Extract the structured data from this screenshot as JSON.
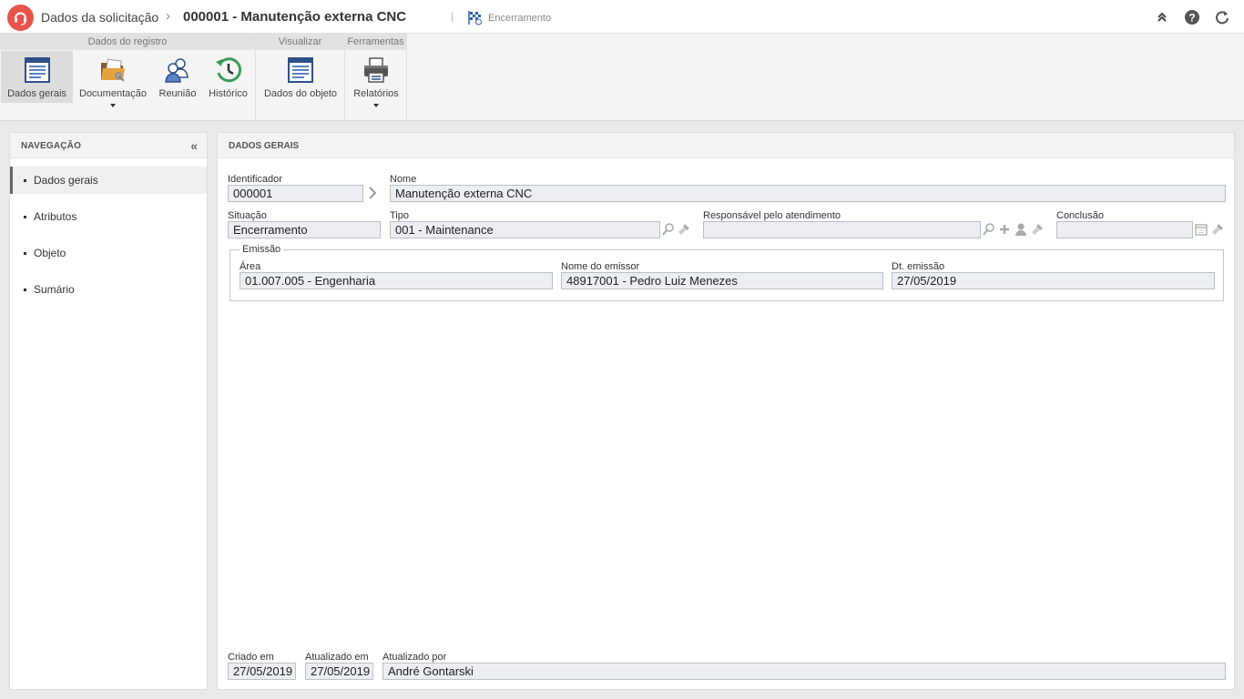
{
  "header": {
    "breadcrumb_root": "Dados da solicitação",
    "breadcrumb_sep": "›",
    "title": "000001 - Manutenção externa CNC",
    "divider": "|",
    "status": "Encerramento"
  },
  "ribbon": {
    "groups": [
      {
        "title": "Dados do registro"
      },
      {
        "title": "Visualizar"
      },
      {
        "title": "Ferramentas"
      }
    ],
    "buttons": {
      "dados_gerais": "Dados gerais",
      "documentacao": "Documentação",
      "reuniao": "Reunião",
      "historico": "Histórico",
      "dados_objeto": "Dados do objeto",
      "relatorios": "Relatórios"
    }
  },
  "nav": {
    "title": "NAVEGAÇÃO",
    "collapse": "«",
    "items": [
      {
        "label": "Dados gerais",
        "active": true
      },
      {
        "label": "Atributos"
      },
      {
        "label": "Objeto"
      },
      {
        "label": "Sumário"
      }
    ]
  },
  "form": {
    "title": "DADOS GERAIS",
    "identificador": {
      "label": "Identificador",
      "value": "000001"
    },
    "nome": {
      "label": "Nome",
      "value": "Manutenção externa CNC"
    },
    "situacao": {
      "label": "Situação",
      "value": "Encerramento"
    },
    "tipo": {
      "label": "Tipo",
      "value": "001 - Maintenance"
    },
    "responsavel": {
      "label": "Responsável pelo atendimento",
      "value": ""
    },
    "conclusao": {
      "label": "Conclusão",
      "value": ""
    },
    "emissao": {
      "legend": "Emissão",
      "area": {
        "label": "Área",
        "value": "01.007.005 - Engenharia"
      },
      "emissor": {
        "label": "Nome do emissor",
        "value": "48917001 - Pedro Luiz Menezes"
      },
      "dt_emissao": {
        "label": "Dt. emissão",
        "value": "27/05/2019"
      }
    },
    "criado_em": {
      "label": "Criado em",
      "value": "27/05/2019"
    },
    "atualizado_em": {
      "label": "Atualizado em",
      "value": "27/05/2019"
    },
    "atualizado_por": {
      "label": "Atualizado por",
      "value": "André Gontarski"
    }
  },
  "icons": {
    "logo": "headset-icon",
    "status": "checkered-flag-icon",
    "collapse_header": "chevron-up-double-icon",
    "help": "help-icon",
    "refresh": "refresh-icon"
  },
  "colors": {
    "brand": "#e8544a",
    "field_bg": "#eceef1",
    "field_border": "#b9c0c8"
  }
}
